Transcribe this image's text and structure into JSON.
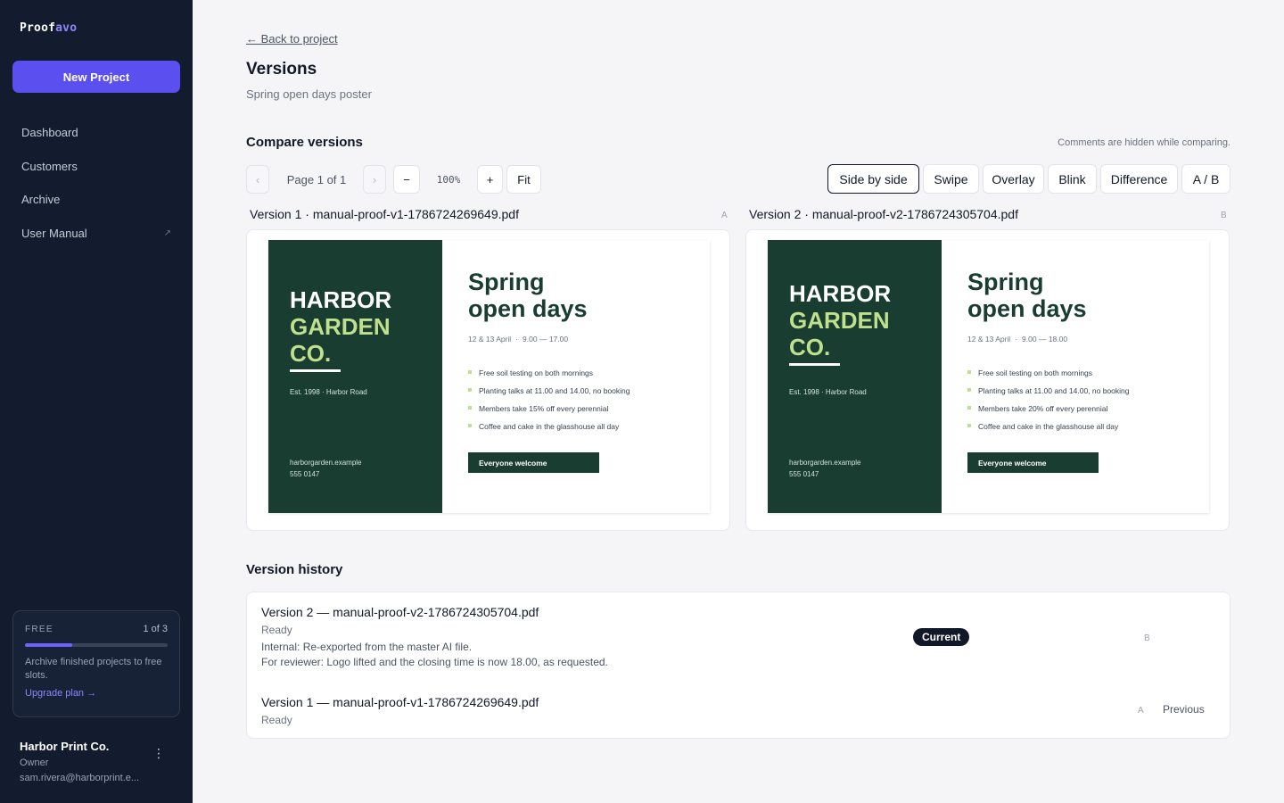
{
  "app": {
    "logo_part1": "Proof",
    "logo_part2": "avo",
    "new_project_label": "New Project",
    "accent_color": "#5b4ff0"
  },
  "sidebar": {
    "items": [
      {
        "label": "Dashboard"
      },
      {
        "label": "Customers"
      },
      {
        "label": "Archive"
      },
      {
        "label": "User Manual",
        "icon": "external-link-icon"
      }
    ],
    "plan": {
      "label": "FREE",
      "count": "1 of 3",
      "progress": 0.33,
      "text": "Archive finished projects to free slots.",
      "upgrade_label": "Upgrade plan →"
    },
    "account": {
      "name": "Harbor Print Co.",
      "role": "Owner",
      "email": "sam.rivera@harborprint.e..."
    }
  },
  "header": {
    "back_label": "← Back to project",
    "title": "Versions",
    "subtitle": "Spring open days poster"
  },
  "compare": {
    "title": "Compare versions",
    "note": "Comments are hidden while comparing.",
    "prev_page": "‹",
    "next_page": "›",
    "page_indicator": "Page 1 of 1",
    "zoom_out": "−",
    "zoom_level": "100%",
    "zoom_in": "+",
    "fit_label": "Fit",
    "modes": [
      {
        "label": "Side by side",
        "active": true
      },
      {
        "label": "Swipe"
      },
      {
        "label": "Overlay"
      },
      {
        "label": "Blink"
      },
      {
        "label": "Difference"
      },
      {
        "label": "A / B"
      }
    ],
    "left": {
      "label": "Version 1 · manual-proof-v1-1786724269649.pdf",
      "letter": "A"
    },
    "right": {
      "label": "Version 2 · manual-proof-v2-1786724305704.pdf",
      "letter": "B"
    }
  },
  "posters": {
    "v1": {
      "brand_l1": "HARBOR",
      "brand_l2": "GARDEN",
      "brand_l3": "CO.",
      "est": "Est. 1998 · Harbor Road",
      "contact_l1": "harborgarden.example",
      "contact_l2": "555 0147",
      "headline_l1": "Spring",
      "headline_l2": "open days",
      "dates": "12 & 13 April",
      "hours": "9.00 — 17.00",
      "bullets": [
        "Free soil testing on both mornings",
        "Planting talks at 11.00 and 14.00, no booking",
        "Members take 15% off every perennial",
        "Coffee and cake in the glasshouse all day"
      ],
      "cta": "Everyone welcome"
    },
    "v2": {
      "brand_l1": "HARBOR",
      "brand_l2": "GARDEN",
      "brand_l3": "CO.",
      "est": "Est. 1998 · Harbor Road",
      "contact_l1": "harborgarden.example",
      "contact_l2": "555 0147",
      "headline_l1": "Spring",
      "headline_l2": "open days",
      "dates": "12 & 13 April",
      "hours": "9.00 — 18.00",
      "bullets": [
        "Free soil testing on both mornings",
        "Planting talks at 11.00 and 14.00, no booking",
        "Members take 20% off every perennial",
        "Coffee and cake in the glasshouse all day"
      ],
      "cta": "Everyone welcome"
    },
    "colors": {
      "dark_green": "#1a3d32",
      "lime": "#bfe08c"
    }
  },
  "history": {
    "title": "Version history",
    "rows": [
      {
        "title": "Version 2 — manual-proof-v2-1786724305704.pdf",
        "status": "Ready",
        "note_internal": "Internal: Re-exported from the master AI file.",
        "note_reviewer": "For reviewer: Logo lifted and the closing time is now 18.00, as requested.",
        "letter": "B",
        "badge": "Current"
      },
      {
        "title": "Version 1 — manual-proof-v1-1786724269649.pdf",
        "status": "Ready",
        "letter": "A",
        "badge": "Previous"
      }
    ]
  }
}
